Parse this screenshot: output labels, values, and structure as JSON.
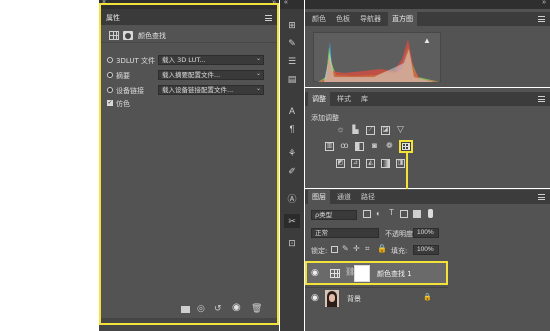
{
  "properties_panel": {
    "title": "属性",
    "subtitle": "颜色查找",
    "options": [
      {
        "label": "3DLUT 文件",
        "value": "载入 3D LUT..."
      },
      {
        "label": "摘要",
        "value": "载入摘要配置文件..."
      },
      {
        "label": "设备链接",
        "value": "载入设备链接配置文件..."
      }
    ],
    "dither_label": "仿色"
  },
  "histogram_panel": {
    "tabs": [
      "颜色",
      "色板",
      "导航器",
      "直方图"
    ],
    "active_tab": "直方图",
    "warning": "▲"
  },
  "adjustments_panel": {
    "tabs": [
      "调整",
      "样式",
      "库"
    ],
    "add_label": "添加调整"
  },
  "layers_panel": {
    "tabs": [
      "图层",
      "通道",
      "路径"
    ],
    "filter_label": "ρ类型",
    "blend_mode": "正常",
    "opacity_label": "不透明度:",
    "opacity_value": "100%",
    "lock_label": "锁定:",
    "fill_label": "填充:",
    "fill_value": "100%",
    "layers": [
      {
        "name": "颜色查找 1",
        "selected": true
      },
      {
        "name": "背景",
        "selected": false
      }
    ]
  },
  "colors": {
    "highlight": "#f2e23a",
    "panel": "#535353",
    "header": "#3c3c3c"
  }
}
